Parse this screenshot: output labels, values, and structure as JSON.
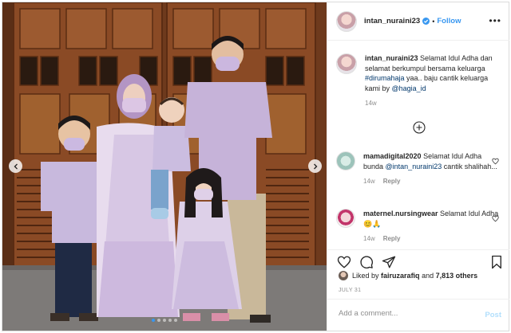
{
  "post": {
    "username": "intan_nuraini23",
    "follow_label": "Follow",
    "separator": "•",
    "more_label": "•••",
    "caption": {
      "username": "intan_nuraini23",
      "text_before": "Selamat Idul Adha dan selamat berkumpul bersama keluarga ",
      "hashtag": "#dirumahaja",
      "text_middle": " yaa.. baju cantik keluarga kami by ",
      "mention": "@hagia_id",
      "time": "14w"
    },
    "comments": [
      {
        "username": "mamadigital2020",
        "text_before": "Selamat Idul Adha bunda ",
        "mention": "@intan_nuraini23",
        "text_after": " cantik shalihah...",
        "time": "14w",
        "reply_label": "Reply"
      },
      {
        "username": "maternel.nursingwear",
        "text_before": "Selamat Idul Adha ",
        "emoji": "😊🙏",
        "text_after": "",
        "time": "14w",
        "reply_label": "Reply"
      }
    ],
    "likes": {
      "prefix": "Liked by ",
      "user": "fairuzarafiq",
      "and": " and ",
      "count": "7,813 others"
    },
    "date": "JULY 31",
    "add_comment_placeholder": "Add a comment...",
    "post_label": "Post"
  },
  "icons": {
    "verified": "verified-badge-icon",
    "more": "more-options-icon",
    "load_more": "load-more-plus-icon",
    "like": "heart-icon",
    "comment": "comment-icon",
    "share": "share-icon",
    "save": "bookmark-icon",
    "prev": "chevron-left-icon",
    "next": "chevron-right-icon"
  },
  "colors": {
    "link": "#3897f0",
    "mention": "#00376b",
    "muted": "#8e8e8e",
    "dress": "#c9b8dc"
  },
  "carousel": {
    "slide_count": 5,
    "active_index": 0
  }
}
